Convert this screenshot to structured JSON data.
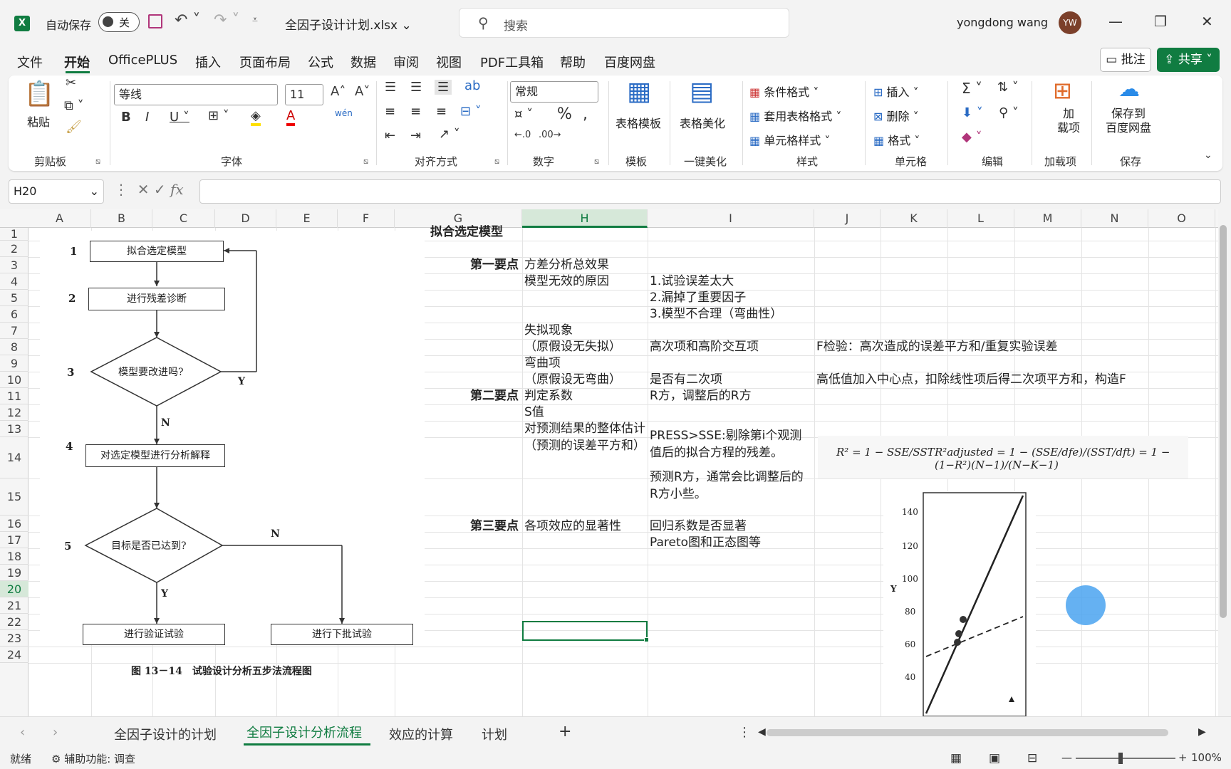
{
  "titlebar": {
    "autosave_label": "自动保存",
    "autosave_state": "关",
    "file_name": "全因子设计计划.xlsx",
    "search_placeholder": "搜索",
    "user_name": "yongdong wang",
    "user_initials": "YW"
  },
  "menu": {
    "tabs": [
      "文件",
      "开始",
      "OfficePLUS",
      "插入",
      "页面布局",
      "公式",
      "数据",
      "审阅",
      "视图",
      "PDF工具箱",
      "帮助",
      "百度网盘"
    ],
    "active": "开始",
    "comments": "批注",
    "share": "共享"
  },
  "ribbon": {
    "clipboard": {
      "paste": "粘贴",
      "label": "剪贴板"
    },
    "font": {
      "name": "等线",
      "size": "11",
      "label": "字体"
    },
    "alignment": {
      "label": "对齐方式"
    },
    "number": {
      "format": "常规",
      "label": "数字"
    },
    "template": {
      "btn": "表格模板",
      "label": "模板"
    },
    "beautify": {
      "btn": "表格美化",
      "label": "一键美化"
    },
    "styles": {
      "cond": "条件格式",
      "table": "套用表格格式",
      "cell": "单元格样式",
      "label": "样式"
    },
    "cells": {
      "insert": "插入",
      "delete": "删除",
      "format": "格式",
      "label": "单元格"
    },
    "editing": {
      "label": "编辑"
    },
    "addins": {
      "btn": "加\n载项",
      "label": "加载项"
    },
    "save": {
      "btn": "保存到\n百度网盘",
      "label": "保存"
    }
  },
  "formula_bar": {
    "name_box": "H20",
    "fx": "fx",
    "value": ""
  },
  "columns": [
    "A",
    "B",
    "C",
    "D",
    "E",
    "F",
    "G",
    "H",
    "I",
    "J",
    "K",
    "L",
    "M",
    "N",
    "O"
  ],
  "selected_column": "H",
  "rows": [
    "1",
    "2",
    "3",
    "4",
    "5",
    "6",
    "7",
    "8",
    "9",
    "10",
    "11",
    "12",
    "13",
    "14",
    "15",
    "16",
    "17",
    "18",
    "19",
    "20",
    "21",
    "22",
    "23",
    "24"
  ],
  "selected_row": "20",
  "cells": {
    "g2": "拟合选定模型",
    "g4": "第一要点",
    "h4": "方差分析总效果",
    "h5": "模型无效的原因",
    "i5": "1.试验误差太大",
    "i6": "2.漏掉了重要因子",
    "i7": "3.模型不合理（弯曲性）",
    "h8": "失拟现象",
    "h9": "（原假设无失拟）",
    "i9": "高次项和高阶交互项",
    "j9": "F检验：高次造成的误差平方和/重复实验误差",
    "h10": "弯曲项",
    "h11": "（原假设无弯曲）",
    "i11": "是否有二次项",
    "j11": "高低值加入中心点，扣除线性项后得二次项平方和，构造F",
    "g12": "第二要点",
    "h12": "判定系数",
    "i12": "R方，调整后的R方",
    "h13": "S值",
    "h14": "对预测结果的整体估计（预测的误差平方和）",
    "i14": "PRESS>SSE:剔除第i个观测值后的拟合方程的残差。",
    "i15": "预测R方，通常会比调整后的R方小些。",
    "g17": "第三要点",
    "h17": "各项效应的显著性",
    "i17": "回归系数是否显著",
    "i18": "Pareto图和正态图等"
  },
  "flowchart": {
    "steps": [
      {
        "num": "1",
        "text": "拟合选定模型"
      },
      {
        "num": "2",
        "text": "进行残差诊断"
      },
      {
        "num": "3",
        "text": "模型要改进吗?"
      },
      {
        "num": "4",
        "text": "对选定模型进行分析解释"
      },
      {
        "num": "5",
        "text": "目标是否已达到?"
      }
    ],
    "verify": "进行验证试验",
    "next_batch": "进行下批试验",
    "yes": "Y",
    "no": "N",
    "caption": "图 13－14　试验设计分析五步法流程图"
  },
  "formula_image": {
    "r2": "R² = 1 − SSE/SST",
    "r2adj": "R²adjusted = 1 − (SSE/dfe)/(SST/dft) = 1 − (1−R²)(N−1)/(N−K−1)"
  },
  "plot_image": {
    "ylabel": "Y",
    "yticks": [
      "140",
      "120",
      "100",
      "80",
      "60",
      "40"
    ]
  },
  "sheets": {
    "tabs": [
      "全因子设计的计划",
      "全因子设计分析流程",
      "效应的计算",
      "计划"
    ],
    "active": "全因子设计分析流程"
  },
  "status": {
    "ready": "就绪",
    "accessibility": "辅助功能: 调查",
    "zoom": "100%"
  },
  "colors": {
    "accent": "#107c41",
    "selection_bg": "#d6e8d9"
  }
}
